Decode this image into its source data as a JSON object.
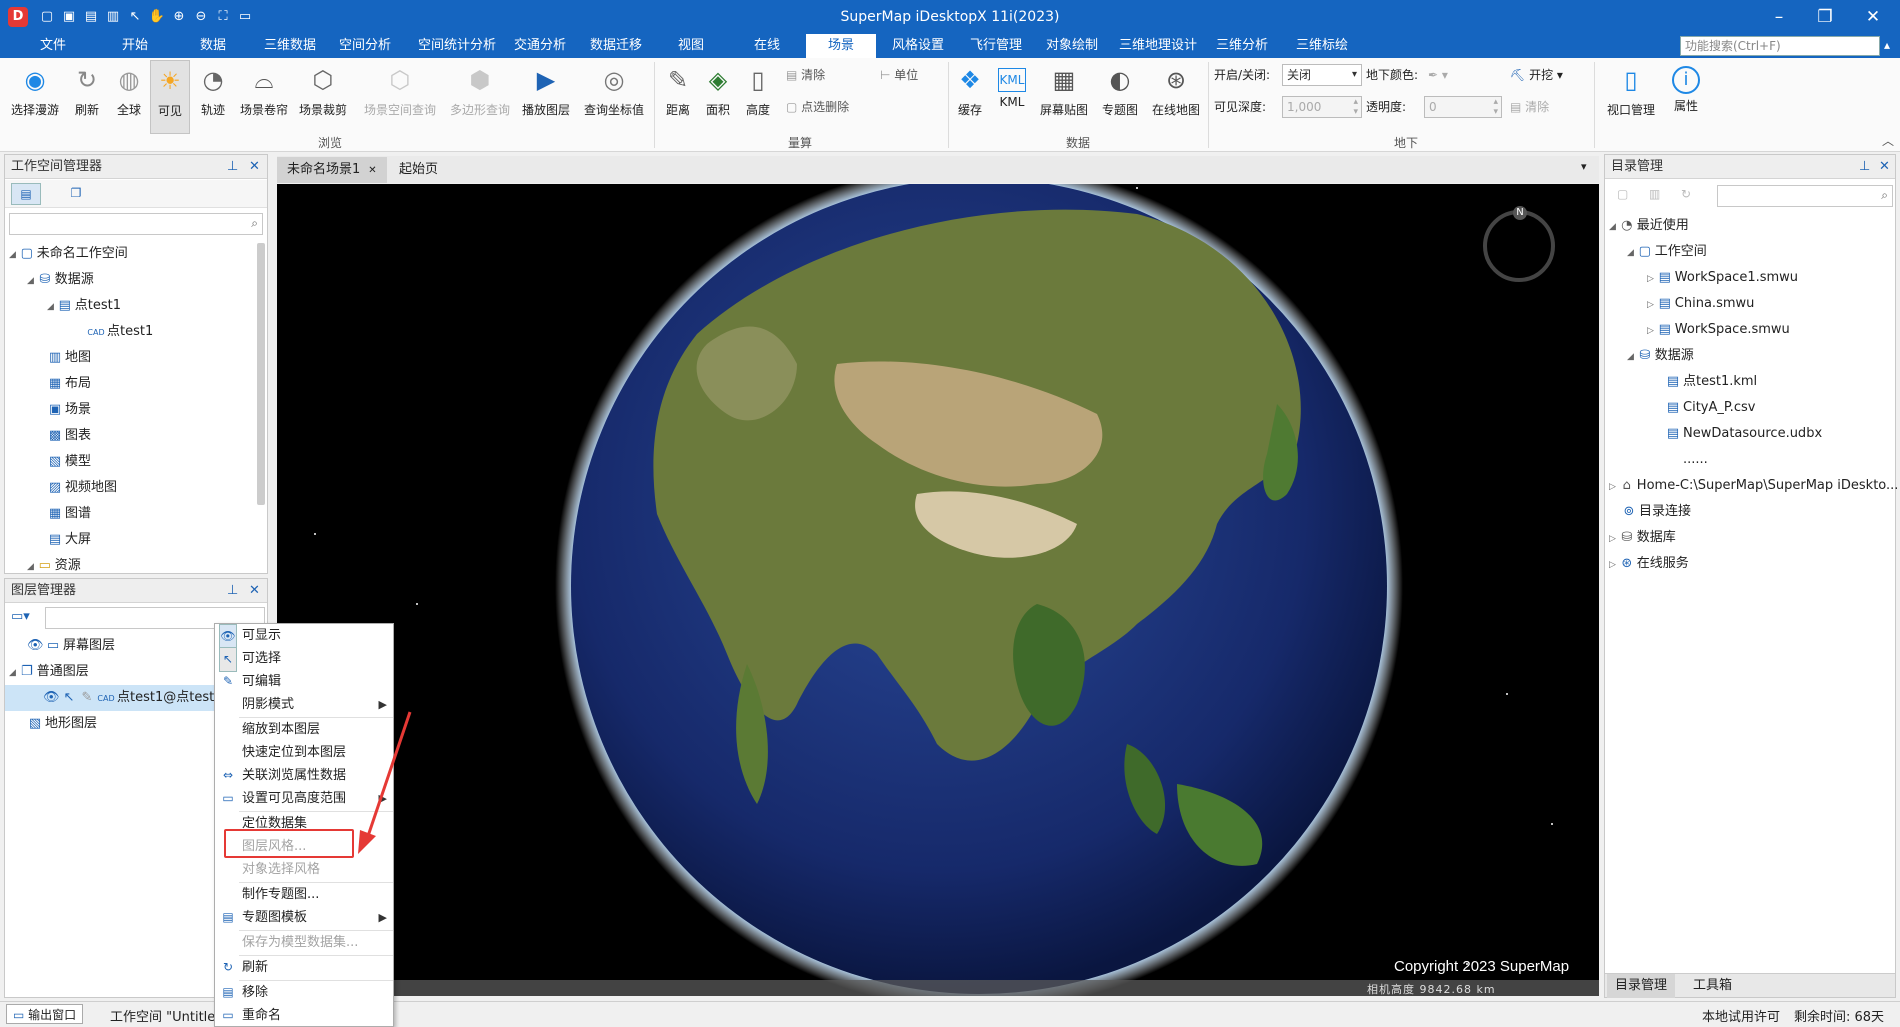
{
  "app_title": "SuperMap iDesktopX 11i(2023)",
  "window_controls": {
    "minimize": "–",
    "restore": "❐",
    "close": "✕"
  },
  "menu": [
    "文件",
    "开始",
    "数据",
    "三维数据",
    "空间分析",
    "空间统计分析",
    "交通分析",
    "数据迁移",
    "视图",
    "在线",
    "场景",
    "风格设置",
    "飞行管理",
    "对象绘制",
    "三维地理设计",
    "三维分析",
    "三维标绘"
  ],
  "active_menu": "场景",
  "function_search_placeholder": "功能搜索(Ctrl+F)",
  "ribbon": {
    "browse": {
      "label": "浏览",
      "buttons": [
        "选择漫游",
        "刷新",
        "全球",
        "可见",
        "轨迹",
        "场景卷帘",
        "场景裁剪",
        "场景空间查询",
        "多边形查询",
        "播放图层",
        "查询坐标值"
      ]
    },
    "measure": {
      "label": "量算",
      "buttons": [
        "距离",
        "面积",
        "高度"
      ],
      "small": [
        "清除",
        "点选删除",
        "单位"
      ]
    },
    "data": {
      "label": "数据",
      "buttons": [
        "缓存",
        "KML",
        "屏幕贴图",
        "专题图",
        "在线地图"
      ]
    },
    "underground": {
      "label": "地下",
      "toggle_label": "开启/关闭:",
      "toggle_value": "关闭",
      "depth_label": "可见深度:",
      "depth_value": "1,000",
      "color_label": "地下颜色:",
      "opacity_label": "透明度:",
      "opacity_value": "0",
      "dig": "开挖",
      "clear": "清除"
    },
    "right": [
      "视口管理",
      "属性"
    ]
  },
  "workspace_manager": {
    "title": "工作空间管理器",
    "tree": [
      "未命名工作空间",
      "数据源",
      "点test1",
      "点test1",
      "地图",
      "布局",
      "场景",
      "图表",
      "模型",
      "视频地图",
      "图谱",
      "大屏",
      "资源"
    ]
  },
  "layer_manager": {
    "title": "图层管理器",
    "tree": [
      "屏幕图层",
      "普通图层",
      "点test1@点test1",
      "地形图层"
    ]
  },
  "scene_tabs": [
    "未命名场景1",
    "起始页"
  ],
  "scene": {
    "copyright": "Copyright 2023 SuperMap",
    "camera": "相机高度 9842.68 km",
    "compass": "N"
  },
  "context_menu": [
    {
      "label": "可显示",
      "disabled": false
    },
    {
      "label": "可选择",
      "disabled": false
    },
    {
      "label": "可编辑",
      "disabled": false
    },
    {
      "label": "阴影模式",
      "disabled": false
    },
    {
      "label": "缩放到本图层",
      "disabled": false
    },
    {
      "label": "快速定位到本图层",
      "disabled": false
    },
    {
      "label": "关联浏览属性数据",
      "disabled": false
    },
    {
      "label": "设置可见高度范围",
      "disabled": false
    },
    {
      "label": "定位数据集",
      "disabled": false
    },
    {
      "label": "图层风格...",
      "disabled": true
    },
    {
      "label": "对象选择风格",
      "disabled": true
    },
    {
      "label": "制作专题图...",
      "disabled": false
    },
    {
      "label": "专题图模板",
      "disabled": false
    },
    {
      "label": "保存为模型数据集...",
      "disabled": true
    },
    {
      "label": "刷新",
      "disabled": false
    },
    {
      "label": "移除",
      "disabled": false
    },
    {
      "label": "重命名",
      "disabled": false
    }
  ],
  "catalog": {
    "title": "目录管理",
    "tree": [
      "最近使用",
      "工作空间",
      "WorkSpace1.smwu",
      "China.smwu",
      "WorkSpace.smwu",
      "数据源",
      "点test1.kml",
      "CityA_P.csv",
      "NewDatasource.udbx",
      "......",
      "Home-C:\\SuperMap\\SuperMap iDeskto...",
      "目录连接",
      "数据库",
      "在线服务"
    ],
    "bottom_tabs": [
      "目录管理",
      "工具箱"
    ]
  },
  "statusbar": {
    "output": "输出窗口",
    "workspace": "工作空间 \"Untitled\"",
    "license": "本地试用许可",
    "remaining": "剩余时间: 68天"
  },
  "colors": {
    "accent": "#1565c0",
    "highlight_box": "#e53935",
    "selected_row": "#cce4f7"
  }
}
